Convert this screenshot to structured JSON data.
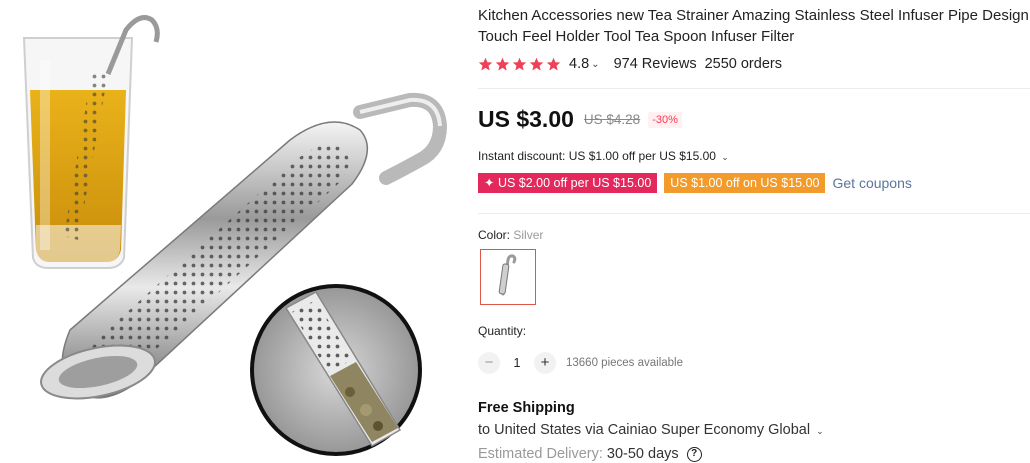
{
  "product": {
    "title": "Kitchen Accessories new Tea Strainer Amazing Stainless Steel Infuser Pipe Design Touch Feel Holder Tool Tea Spoon Infuser Filter",
    "rating": "4.8",
    "reviews": "974 Reviews",
    "orders": "2550 orders"
  },
  "price": {
    "current": "US $3.00",
    "original": "US $4.28",
    "discount": "-30%"
  },
  "instant_discount": {
    "label": "Instant discount: US $1.00 off per US $15.00"
  },
  "coupons": {
    "coupon1": "✦ US $2.00 off per US $15.00",
    "coupon2": "US $1.00 off on US $15.00",
    "get_coupons": "Get coupons"
  },
  "color": {
    "label": "Color:",
    "value": "Silver"
  },
  "quantity": {
    "label": "Quantity:",
    "value": "1",
    "minus": "−",
    "plus": "+",
    "available": "13660 pieces available"
  },
  "shipping": {
    "title": "Free Shipping",
    "route": "to United States via Cainiao Super Economy Global",
    "delivery_label": "Estimated Delivery:",
    "delivery_value": "30-50 days",
    "help": "?"
  },
  "colors": {
    "star": "#ef4058",
    "coupon_red": "#e3285c",
    "coupon_orange": "#f29b2b",
    "link": "#5a76a0",
    "selected_border": "#e0554a"
  },
  "icons": [
    "star-icon",
    "chevron-down-icon",
    "help-icon",
    "minus-icon",
    "plus-icon"
  ]
}
